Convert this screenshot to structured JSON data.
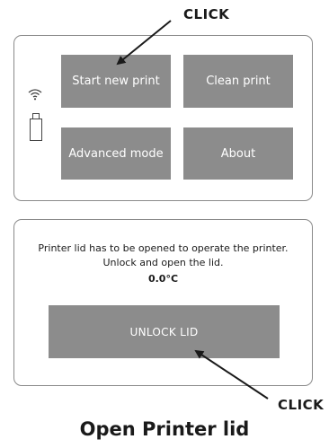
{
  "annotations": {
    "callout_top": "CLICK",
    "callout_bottom": "CLICK",
    "caption": "Open Printer lid"
  },
  "home_screen": {
    "status_icons": [
      "wifi-icon",
      "usb-drive-icon"
    ],
    "buttons": {
      "start_new_print": "Start new print",
      "clean_print": "Clean print",
      "advanced_mode": "Advanced mode",
      "about": "About"
    }
  },
  "lid_screen": {
    "message_line1": "Printer lid has to be opened to operate the printer.",
    "message_line2": "Unlock and open the lid.",
    "temperature": "0.0°C",
    "unlock_button": "UNLOCK LID"
  },
  "colors": {
    "button_fill": "#8c8c8c",
    "button_text": "#ffffff",
    "screen_border": "#8a8a8a",
    "annotation": "#1a1a1a"
  }
}
